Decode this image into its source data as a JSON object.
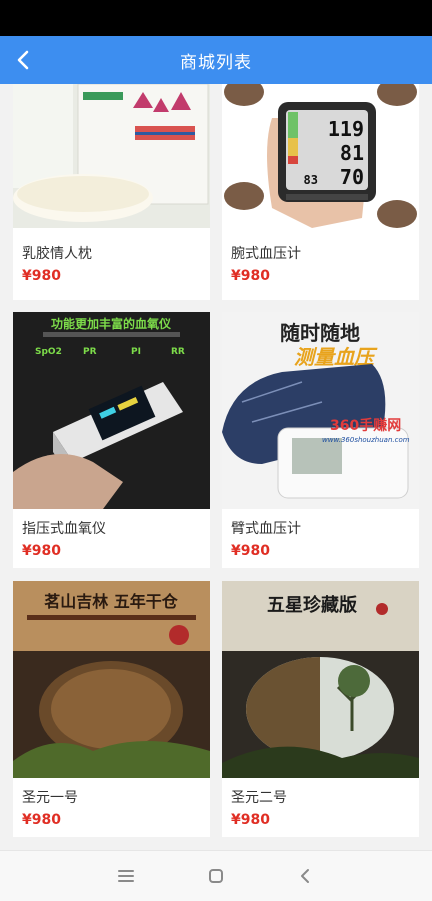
{
  "header": {
    "title": "商城列表"
  },
  "products": [
    {
      "name": "乳胶情人枕",
      "price": "¥980",
      "image": "pillow"
    },
    {
      "name": "腕式血压计",
      "price": "¥980",
      "image": "wrist-monitor",
      "image_text": {
        "l1": "119",
        "l2": "81",
        "l3": "70",
        "top": "83"
      }
    },
    {
      "name": "指压式血氧仪",
      "price": "¥980",
      "image": "oximeter",
      "image_text": {
        "headline": "功能更加丰富的血氧仪",
        "badges": [
          "SpO2",
          "PR",
          "PI",
          "RR"
        ]
      }
    },
    {
      "name": "臂式血压计",
      "price": "¥980",
      "image": "arm-monitor",
      "image_text": {
        "l1": "随时随地",
        "l2": "测量血压",
        "watermark": "360手赚网",
        "watermark_url": "www.360shouzhuan.com"
      }
    },
    {
      "name": "圣元一号",
      "price": "¥980",
      "image": "tea-cake-1",
      "image_text": {
        "headline": "茗山吉林 五年干仓"
      }
    },
    {
      "name": "圣元二号",
      "price": "¥980",
      "image": "tea-cake-2",
      "image_text": {
        "headline": "五星珍藏版"
      }
    }
  ],
  "colors": {
    "nav": "#3d8ef0",
    "price": "#e02e24"
  },
  "system_nav": [
    "menu-icon",
    "home-icon",
    "back-icon"
  ]
}
